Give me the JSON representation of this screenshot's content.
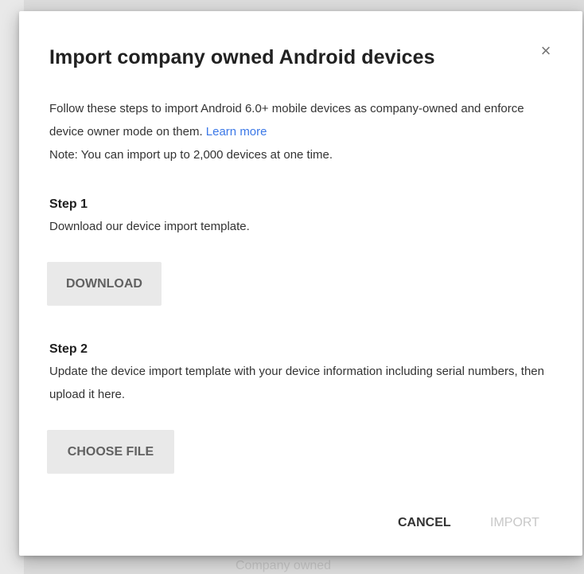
{
  "dialog": {
    "title": "Import company owned Android devices",
    "close_glyph": "×",
    "intro": {
      "text": "Follow these steps to import Android 6.0+ mobile devices as company-owned and enforce device owner mode on them.",
      "learn_more": "Learn more",
      "note": "Note: You can import up to 2,000 devices at one time."
    },
    "step1": {
      "heading": "Step 1",
      "text": "Download our device import template.",
      "button_label": "DOWNLOAD"
    },
    "step2": {
      "heading": "Step 2",
      "text": "Update the device import template with your device information including serial numbers, then upload it here.",
      "button_label": "CHOOSE FILE"
    },
    "footer": {
      "cancel_label": "CANCEL",
      "import_label": "IMPORT"
    }
  },
  "background": {
    "footer_text": "Company owned"
  },
  "colors": {
    "link": "#3b78e7",
    "disabled_button_text": "#c8c8c8",
    "primary_text": "#212121",
    "button_fill": "#e9e9e9"
  }
}
